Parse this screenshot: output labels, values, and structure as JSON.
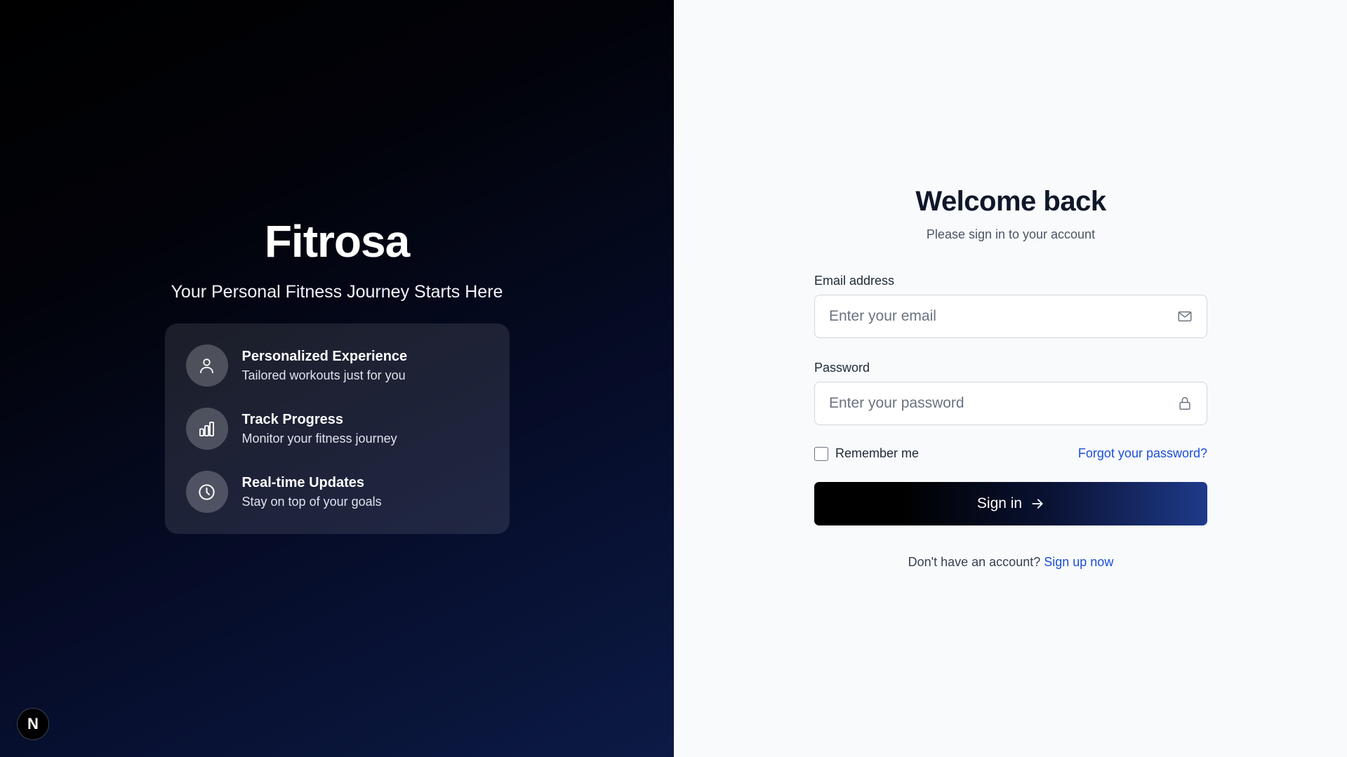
{
  "hero": {
    "brand": "Fitrosa",
    "tagline": "Your Personal Fitness Journey Starts Here",
    "features": [
      {
        "icon": "user-icon",
        "title": "Personalized Experience",
        "description": "Tailored workouts just for you"
      },
      {
        "icon": "bar-chart-icon",
        "title": "Track Progress",
        "description": "Monitor your fitness journey"
      },
      {
        "icon": "clock-icon",
        "title": "Real-time Updates",
        "description": "Stay on top of your goals"
      }
    ],
    "badge_letter": "N"
  },
  "form": {
    "heading": "Welcome back",
    "subheading": "Please sign in to your account",
    "email": {
      "label": "Email address",
      "placeholder": "Enter your email",
      "value": "",
      "icon": "mail-icon"
    },
    "password": {
      "label": "Password",
      "placeholder": "Enter your password",
      "value": "",
      "icon": "lock-icon"
    },
    "remember_label": "Remember me",
    "remember_checked": false,
    "forgot_link": "Forgot your password?",
    "signin_label": "Sign in",
    "signin_icon": "arrow-right-icon",
    "signup_prompt": "Don't have an account?",
    "signup_link": "Sign up now"
  },
  "colors": {
    "hero_bg_start": "#000000",
    "hero_bg_end": "#0c1a45",
    "form_bg": "#f8fafc",
    "link": "#1d4ed8",
    "button_gradient_end": "#1e3a8a"
  }
}
